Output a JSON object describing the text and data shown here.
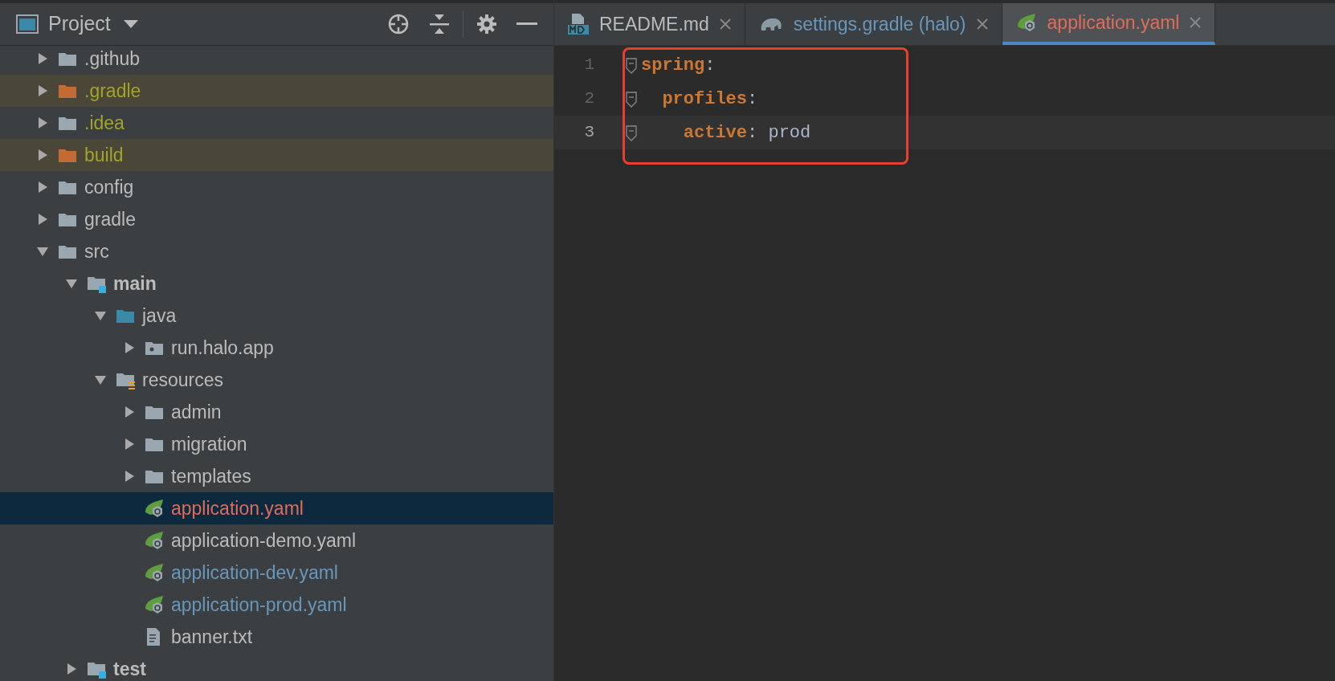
{
  "project_panel": {
    "title": "Project",
    "tree": [
      {
        "name": ".github",
        "kind": "folder",
        "color": "#bbbbbb",
        "expanded": false
      },
      {
        "name": ".gradle",
        "kind": "excluded_folder",
        "color": "#a3a32a",
        "expanded": false
      },
      {
        "name": ".idea",
        "kind": "folder",
        "color": "#a3a32a",
        "expanded": false
      },
      {
        "name": "build",
        "kind": "excluded_folder",
        "color": "#a3a32a",
        "expanded": false
      },
      {
        "name": "config",
        "kind": "folder",
        "color": "#bbbbbb",
        "expanded": false
      },
      {
        "name": "gradle",
        "kind": "folder",
        "color": "#bbbbbb",
        "expanded": false
      },
      {
        "name": "src",
        "kind": "folder",
        "color": "#bbbbbb",
        "expanded": true,
        "children": [
          {
            "name": "main",
            "kind": "module_folder",
            "color": "#bbbbbb",
            "bold": true,
            "expanded": true,
            "children": [
              {
                "name": "java",
                "kind": "source_folder",
                "color": "#bbbbbb",
                "expanded": true,
                "children": [
                  {
                    "name": "run.halo.app",
                    "kind": "package",
                    "color": "#bbbbbb",
                    "expanded": false
                  }
                ]
              },
              {
                "name": "resources",
                "kind": "resources_folder",
                "color": "#bbbbbb",
                "expanded": true,
                "children": [
                  {
                    "name": "admin",
                    "kind": "folder",
                    "color": "#bbbbbb",
                    "expanded": false
                  },
                  {
                    "name": "migration",
                    "kind": "folder",
                    "color": "#bbbbbb",
                    "expanded": false
                  },
                  {
                    "name": "templates",
                    "kind": "folder",
                    "color": "#bbbbbb",
                    "expanded": false
                  },
                  {
                    "name": "application.yaml",
                    "kind": "spring_file",
                    "color": "#e06c5a",
                    "selected": true
                  },
                  {
                    "name": "application-demo.yaml",
                    "kind": "spring_file",
                    "color": "#bbbbbb",
                    "selected": false
                  },
                  {
                    "name": "application-dev.yaml",
                    "kind": "spring_file",
                    "color": "#6897bb",
                    "selected": false
                  },
                  {
                    "name": "application-prod.yaml",
                    "kind": "spring_file",
                    "color": "#6897bb",
                    "selected": false
                  },
                  {
                    "name": "banner.txt",
                    "kind": "text_file",
                    "color": "#bbbbbb",
                    "selected": false
                  }
                ]
              }
            ]
          },
          {
            "name": "test",
            "kind": "module_folder",
            "color": "#bbbbbb",
            "bold": true,
            "expanded": false
          }
        ]
      }
    ]
  },
  "editor": {
    "tabs": [
      {
        "label": "README.md",
        "kind": "markdown",
        "color": "#bbbbbb",
        "selected": false
      },
      {
        "label": "settings.gradle (halo)",
        "kind": "gradle",
        "color": "#6897bb",
        "selected": false
      },
      {
        "label": "application.yaml",
        "kind": "spring",
        "color": "#e06c5a",
        "selected": true
      }
    ],
    "lines": [
      {
        "number": "1",
        "current": false,
        "tokens": [
          {
            "text": "spring",
            "kind": "key"
          },
          {
            "text": ":",
            "kind": "punct"
          }
        ]
      },
      {
        "number": "2",
        "current": false,
        "tokens": [
          {
            "text": "  profiles",
            "kind": "key"
          },
          {
            "text": ":",
            "kind": "punct"
          }
        ]
      },
      {
        "number": "3",
        "current": true,
        "tokens": [
          {
            "text": "    active",
            "kind": "key"
          },
          {
            "text": ": ",
            "kind": "punct"
          },
          {
            "text": "prod",
            "kind": "value"
          }
        ]
      }
    ]
  }
}
